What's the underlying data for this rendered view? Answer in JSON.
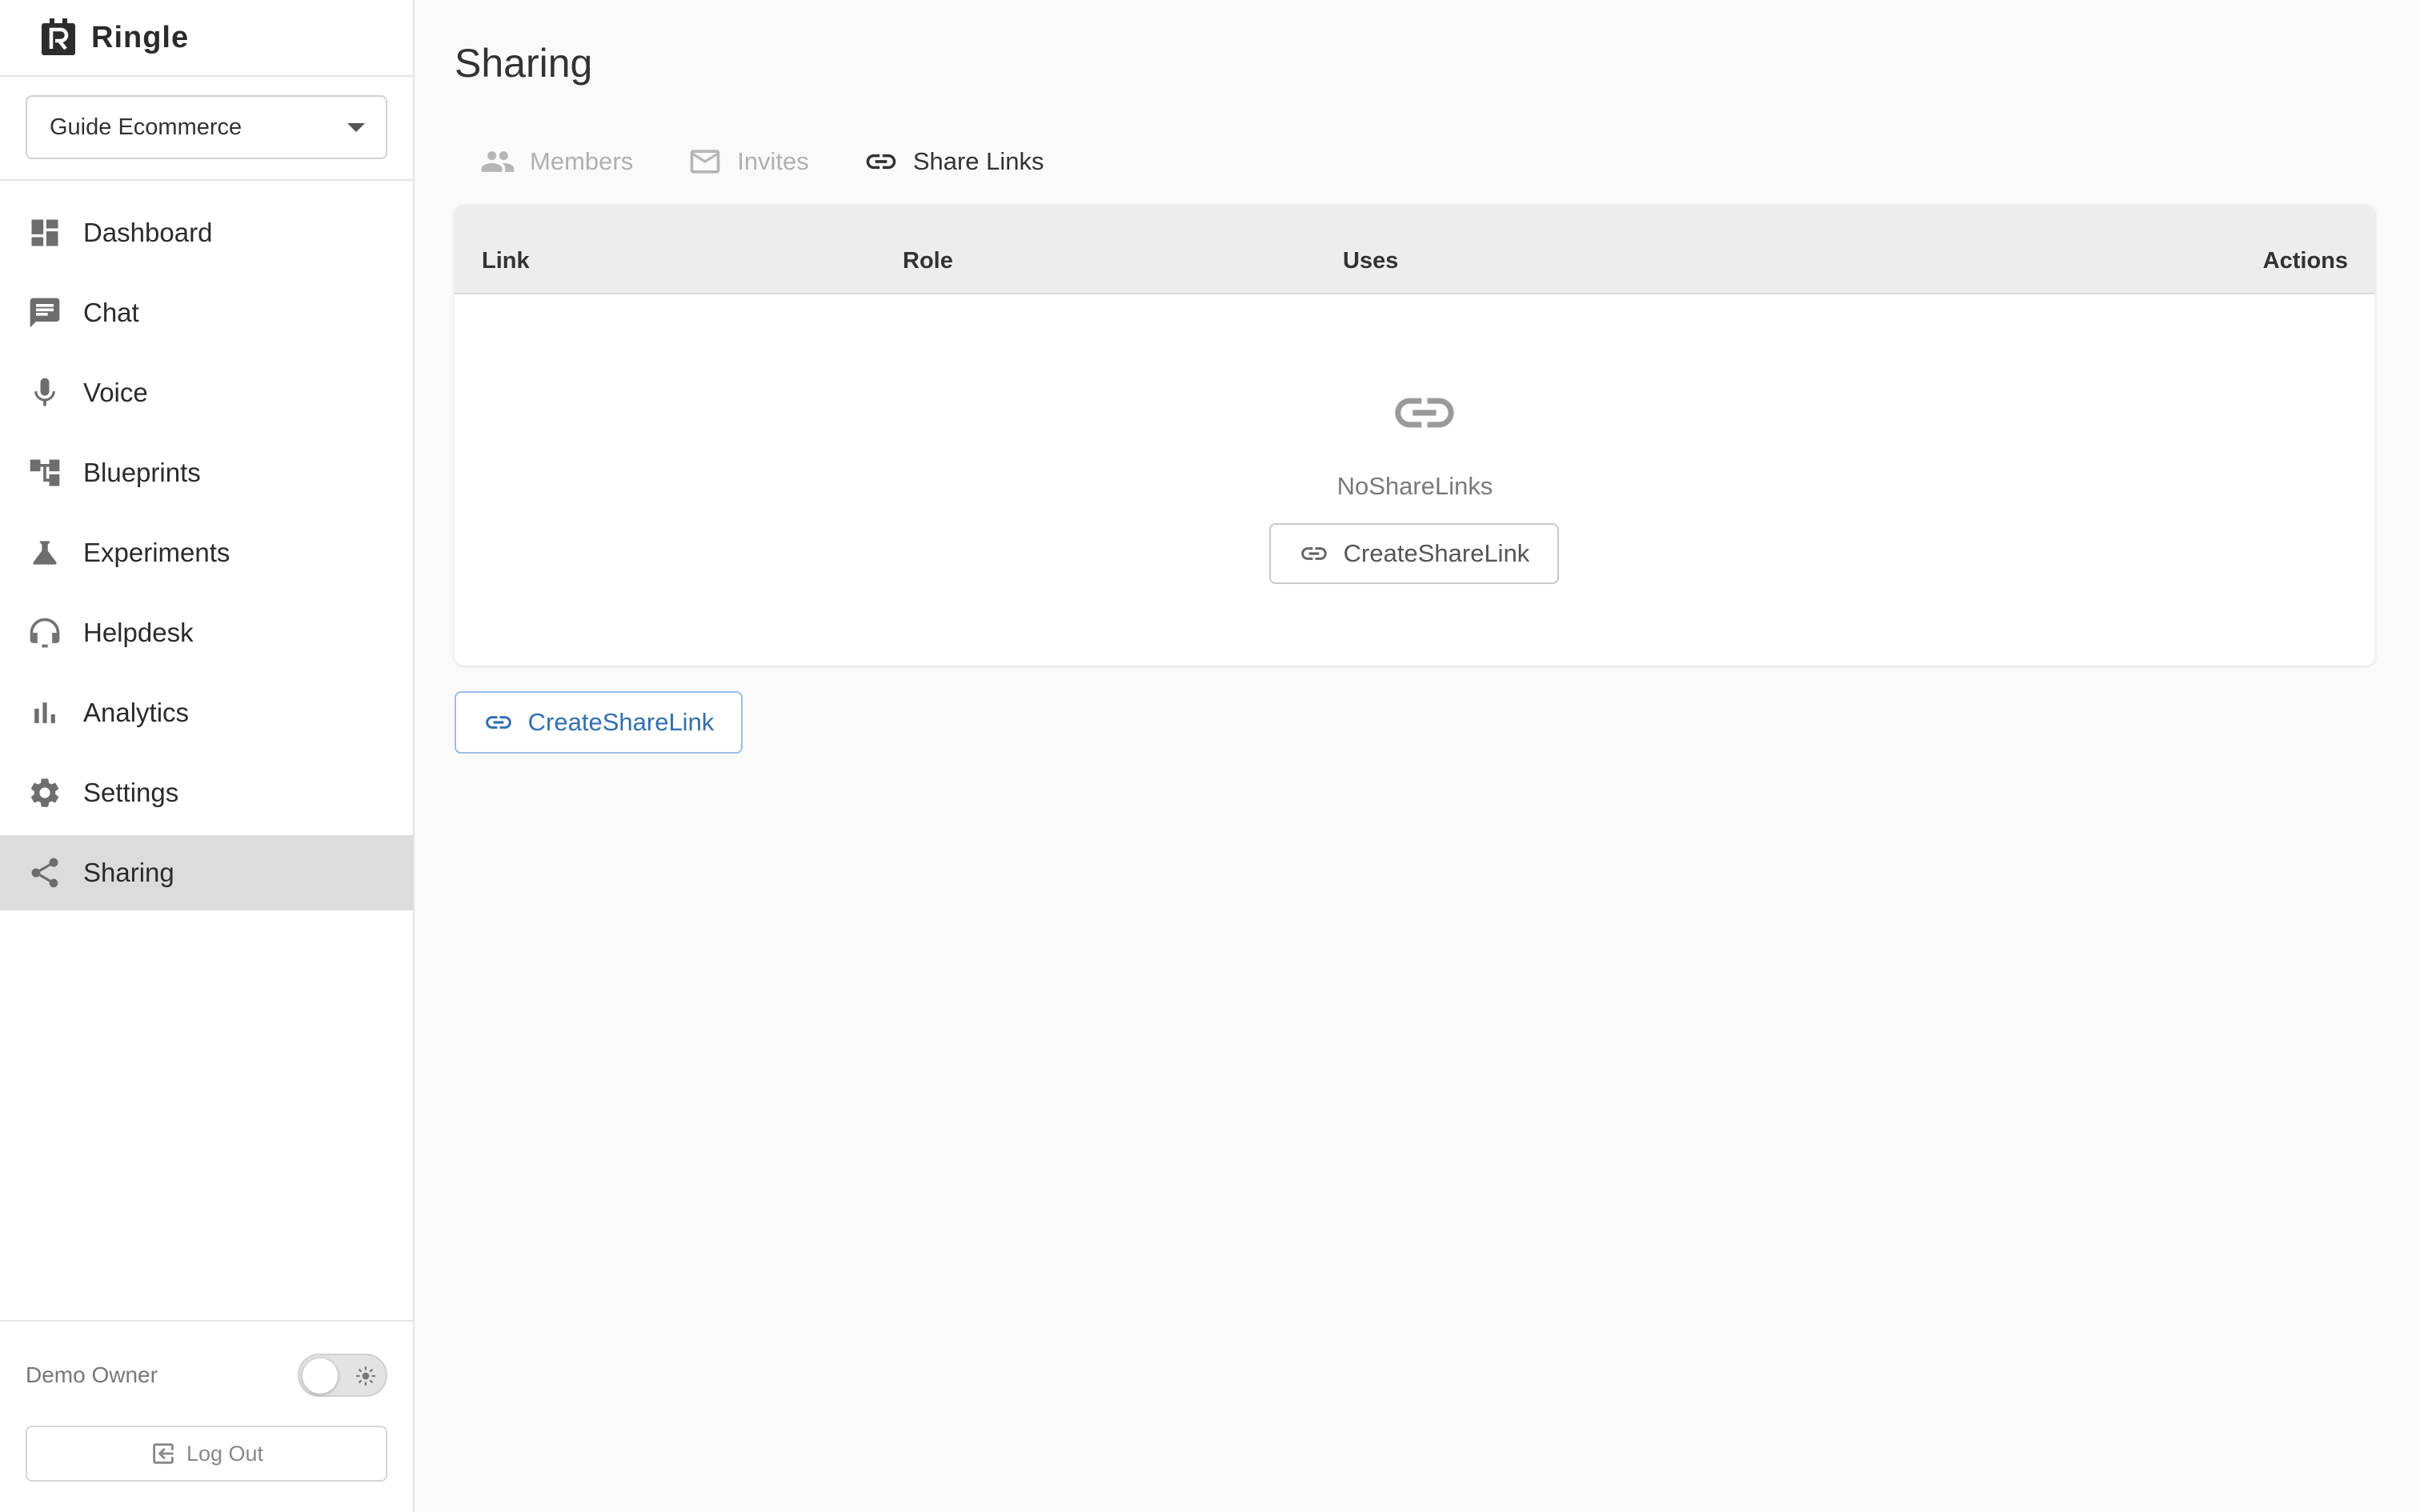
{
  "app": {
    "name": "Ringle"
  },
  "project_selector": {
    "value": "Guide Ecommerce"
  },
  "sidebar": {
    "items": [
      {
        "label": "Dashboard",
        "icon": "dashboard-icon"
      },
      {
        "label": "Chat",
        "icon": "chat-icon"
      },
      {
        "label": "Voice",
        "icon": "microphone-icon"
      },
      {
        "label": "Blueprints",
        "icon": "blueprint-icon"
      },
      {
        "label": "Experiments",
        "icon": "flask-icon"
      },
      {
        "label": "Helpdesk",
        "icon": "headset-icon"
      },
      {
        "label": "Analytics",
        "icon": "bar-chart-icon"
      },
      {
        "label": "Settings",
        "icon": "gear-icon"
      },
      {
        "label": "Sharing",
        "icon": "share-icon",
        "active": true
      }
    ]
  },
  "user": {
    "name": "Demo Owner",
    "theme_toggle": "light"
  },
  "logout": {
    "label": "Log Out"
  },
  "page": {
    "title": "Sharing"
  },
  "tabs": [
    {
      "label": "Members",
      "icon": "people-icon"
    },
    {
      "label": "Invites",
      "icon": "mail-icon"
    },
    {
      "label": "Share Links",
      "icon": "link-icon",
      "active": true
    }
  ],
  "table": {
    "columns": [
      "Link",
      "Role",
      "Uses",
      "Actions"
    ],
    "rows": [],
    "empty_text": "NoShareLinks",
    "empty_button_label": "CreateShareLink"
  },
  "create_button": {
    "label": "CreateShareLink"
  },
  "colors": {
    "accent": "#2e70b8",
    "active_nav": "#dcdcdc"
  }
}
